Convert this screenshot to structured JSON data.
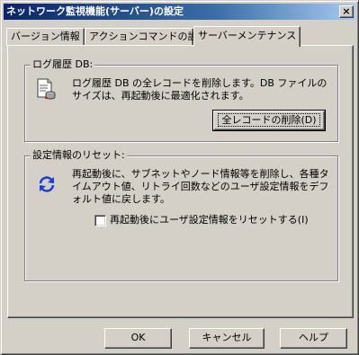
{
  "window": {
    "title": "ネットワーク監視機能(サーバー)の設定",
    "close_glyph": "×"
  },
  "tabs": [
    {
      "label": "バージョン情報",
      "active": false
    },
    {
      "label": "アクションコマンドの設定",
      "active": false
    },
    {
      "label": "サーバーメンテナンス",
      "active": true
    }
  ],
  "log_db": {
    "group_label": "ログ履歴 DB:",
    "icon": "database-document-icon",
    "description": "ログ履歴 DB の全レコードを削除します。DB ファイルのサイズは、再起動後に最適化されます。",
    "delete_button": "全レコードの削除(D)"
  },
  "reset": {
    "group_label": "設定情報のリセット:",
    "icon": "refresh-arrows-icon",
    "description": "再起動後に、サブネットやノード情報等を削除し、各種タイムアウト値、リトライ回数などのユーザ設定情報をデフォルト値に戻します。",
    "checkbox_label": "再起動後にユーザ設定情報をリセットする(I)",
    "checkbox_checked": false
  },
  "footer": {
    "ok": "OK",
    "cancel": "キャンセル",
    "help": "ヘルプ"
  },
  "colors": {
    "face": "#d4d0c8",
    "title_start": "#0a246a",
    "title_end": "#a6caf0",
    "icon_blue": "#1a3fd0"
  }
}
